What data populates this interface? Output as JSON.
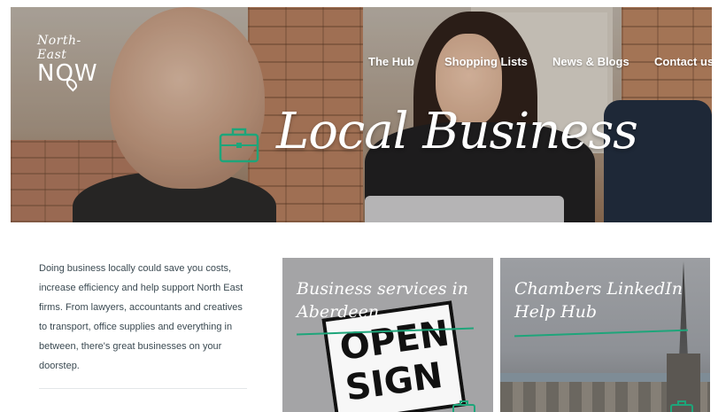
{
  "brand": {
    "line1": "North-East",
    "line2": "NOW"
  },
  "nav": {
    "items": [
      {
        "label": "The Hub"
      },
      {
        "label": "Shopping Lists"
      },
      {
        "label": "News & Blogs"
      },
      {
        "label": "Contact us"
      }
    ]
  },
  "hero": {
    "title": "Local Business",
    "icon": "briefcase-icon"
  },
  "intro": {
    "text": "Doing business locally could save you costs, increase efficiency and help support North East firms. From lawyers, accountants and creatives to transport, office supplies and everything in between, there's great businesses on your doorstep."
  },
  "cards": [
    {
      "title": "Business services in Aberdeen",
      "sign_line1": "OPEN",
      "sign_line2": "SIGN"
    },
    {
      "title": "Chambers LinkedIn Help Hub"
    }
  ],
  "colors": {
    "accent": "#1ea57a",
    "text": "#3b4a52"
  }
}
